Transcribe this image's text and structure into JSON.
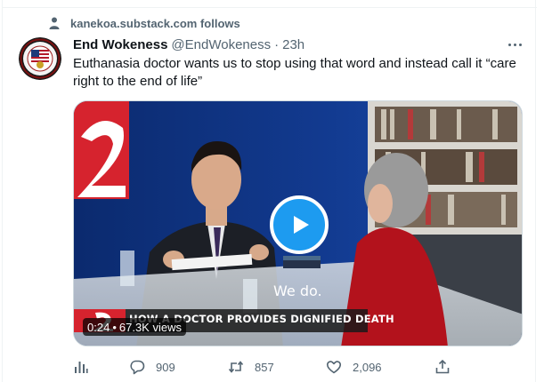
{
  "social_context": {
    "text": "kanekoa.substack.com follows"
  },
  "author": {
    "display_name": "End Wokeness",
    "handle": "@EndWokeness",
    "separator": "·",
    "timestamp": "23h"
  },
  "tweet": {
    "text": "Euthanasia doctor wants us to stop using that word and instead call it “care right to the end of life”"
  },
  "media": {
    "subtitle": "We do.",
    "caption": "HOW A DOCTOR PROVIDES DIGNIFIED DEATH",
    "duration": "0:24",
    "views_separator": "•",
    "views": "67.3K views",
    "channel_logo_text": "2"
  },
  "actions": {
    "analytics": {
      "icon": "analytics-icon"
    },
    "reply": {
      "icon": "reply-icon",
      "count": "909"
    },
    "retweet": {
      "icon": "retweet-icon",
      "count": "857"
    },
    "like": {
      "icon": "heart-icon",
      "count": "2,096"
    },
    "share": {
      "icon": "share-icon"
    }
  },
  "colors": {
    "accent": "#1d9bf0",
    "muted": "#536471",
    "text": "#0f1419",
    "border": "#eff3f4"
  }
}
